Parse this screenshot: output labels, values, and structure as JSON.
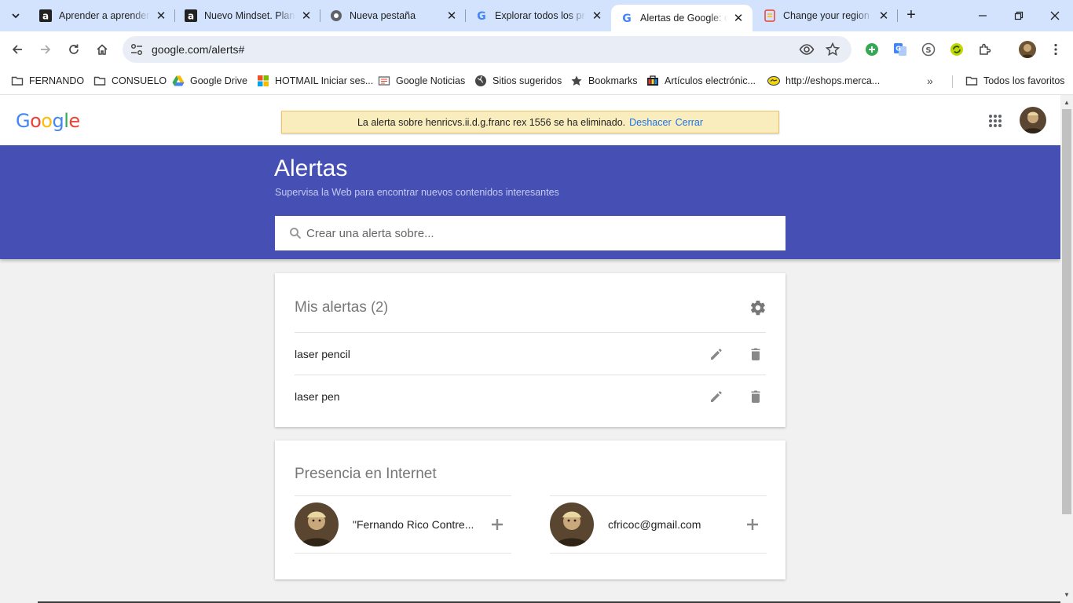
{
  "browser": {
    "tabs": [
      {
        "title": "Aprender a aprender:",
        "favicon": "academia-icon"
      },
      {
        "title": "Nuevo Mindset. Planif",
        "favicon": "academia-icon"
      },
      {
        "title": "Nueva pestaña",
        "favicon": "chrome-icon"
      },
      {
        "title": "Explorar todos los pro",
        "favicon": "google-icon"
      },
      {
        "title": "Alertas de Google: co",
        "favicon": "google-icon",
        "active": true
      },
      {
        "title": "Change your region a",
        "favicon": "google-doc-icon"
      }
    ],
    "url": "google.com/alerts#",
    "bookmarks": [
      {
        "label": "FERNANDO",
        "icon": "folder-icon"
      },
      {
        "label": "CONSUELO",
        "icon": "folder-icon"
      },
      {
        "label": "Google Drive",
        "icon": "drive-icon"
      },
      {
        "label": "HOTMAIL Iniciar ses...",
        "icon": "windows-icon"
      },
      {
        "label": "Google Noticias",
        "icon": "news-icon"
      },
      {
        "label": "Sitios sugeridos",
        "icon": "globe-icon"
      },
      {
        "label": "Bookmarks",
        "icon": "star-icon"
      },
      {
        "label": "Artículos electrónic...",
        "icon": "shop-icon"
      },
      {
        "label": "http://eshops.merca...",
        "icon": "handshake-icon"
      }
    ],
    "all_bookmarks_label": "Todos los favoritos"
  },
  "header": {
    "logo": "Google",
    "banner": {
      "message": "La alerta sobre henricvs.ii.d.g.franc rex 1556 se ha eliminado.",
      "undo": "Deshacer",
      "close": "Cerrar"
    }
  },
  "hero": {
    "title": "Alertas",
    "subtitle": "Supervisa la Web para encontrar nuevos contenidos interesantes",
    "search_placeholder": "Crear una alerta sobre..."
  },
  "alerts_card": {
    "title": "Mis alertas",
    "count": "(2)",
    "items": [
      {
        "name": "laser pencil"
      },
      {
        "name": "laser pen"
      }
    ]
  },
  "presence_card": {
    "title": "Presencia en Internet",
    "items": [
      {
        "name": "\"Fernando Rico Contre..."
      },
      {
        "name": "cfricoc@gmail.com"
      }
    ]
  },
  "colors": {
    "hero_bg": "#4650b4",
    "banner_bg": "#f9edbe",
    "link": "#1a73e8",
    "tabstrip": "#d3e3fd"
  }
}
